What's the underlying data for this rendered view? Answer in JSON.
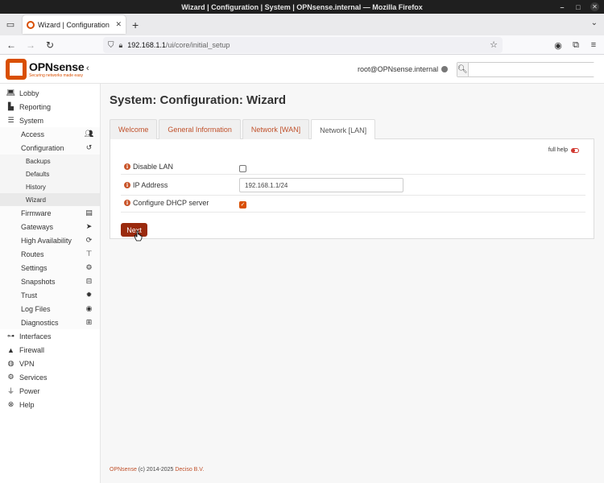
{
  "window": {
    "title": "Wizard | Configuration | System | OPNsense.internal — Mozilla Firefox",
    "controls": [
      "minimize-icon",
      "maximize-icon",
      "close-icon"
    ]
  },
  "browser": {
    "tab_title": "Wizard | Configuration | Sys",
    "url_host": "192.168.1.1",
    "url_path": "/ui/core/initial_setup"
  },
  "header": {
    "logo_name": "OPNsense",
    "logo_tagline": "Securing networks made easy",
    "user": "root@OPNsense.internal",
    "search_placeholder": ""
  },
  "sidebar": {
    "items": [
      {
        "label": "Lobby",
        "icon": "laptop-icon"
      },
      {
        "label": "Reporting",
        "icon": "area-chart-icon"
      },
      {
        "label": "System",
        "icon": "server-icon"
      },
      {
        "label": "Access",
        "icon": "users-icon"
      },
      {
        "label": "Configuration",
        "icon": "history-icon"
      },
      {
        "label": "Backups"
      },
      {
        "label": "Defaults"
      },
      {
        "label": "History"
      },
      {
        "label": "Wizard"
      },
      {
        "label": "Firmware",
        "icon": "building-icon"
      },
      {
        "label": "Gateways",
        "icon": "location-arrow-icon"
      },
      {
        "label": "High Availability",
        "icon": "refresh-icon"
      },
      {
        "label": "Routes",
        "icon": "map-signs-icon"
      },
      {
        "label": "Settings",
        "icon": "cogs-icon"
      },
      {
        "label": "Snapshots",
        "icon": "hdd-icon"
      },
      {
        "label": "Trust",
        "icon": "certificate-icon"
      },
      {
        "label": "Log Files",
        "icon": "eye-icon"
      },
      {
        "label": "Diagnostics",
        "icon": "medkit-icon"
      },
      {
        "label": "Interfaces",
        "icon": "sitemap-icon"
      },
      {
        "label": "Firewall",
        "icon": "fire-icon"
      },
      {
        "label": "VPN",
        "icon": "globe-icon"
      },
      {
        "label": "Services",
        "icon": "cog-icon"
      },
      {
        "label": "Power",
        "icon": "plug-icon"
      },
      {
        "label": "Help",
        "icon": "life-ring-icon"
      }
    ]
  },
  "main": {
    "title": "System: Configuration: Wizard",
    "tabs": [
      {
        "label": "Welcome",
        "active": false
      },
      {
        "label": "General Information",
        "active": false
      },
      {
        "label": "Network [WAN]",
        "active": false
      },
      {
        "label": "Network [LAN]",
        "active": true
      }
    ],
    "full_help": "full help",
    "fields": {
      "disable_lan": {
        "label": "Disable LAN",
        "checked": false
      },
      "ip_address": {
        "label": "IP Address",
        "value": "192.168.1.1/24"
      },
      "configure_dhcp": {
        "label": "Configure DHCP server",
        "checked": true,
        "mark": "✓"
      }
    },
    "next_button": "Next"
  },
  "footer": {
    "brand": "OPNsense",
    "text": " (c) 2014-2025 ",
    "company": "Deciso B.V."
  },
  "colors": {
    "accent": "#d94f00",
    "link": "#c0502a",
    "button": "#9a2a0e"
  }
}
